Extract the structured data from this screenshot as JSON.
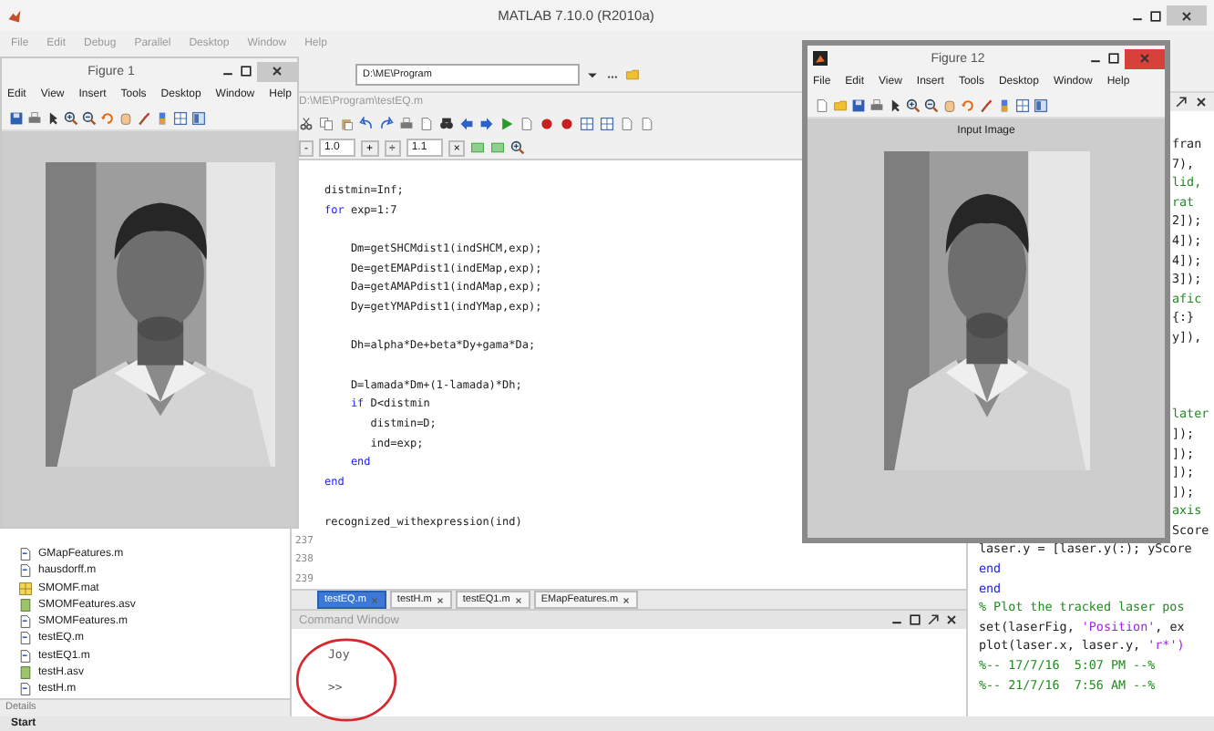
{
  "matlab_window": {
    "title": "MATLAB 7.10.0 (R2010a)",
    "menu": [
      "File",
      "Edit",
      "Debug",
      "Parallel",
      "Desktop",
      "Window",
      "Help"
    ],
    "current_folder": "D:\\ME\\Program"
  },
  "file_browser": {
    "files": [
      {
        "name": "GMapFeatures.m",
        "kind": "script"
      },
      {
        "name": "hausdorff.m",
        "kind": "script"
      },
      {
        "name": "SMOMF.mat",
        "kind": "matrix"
      },
      {
        "name": "SMOMFeatures.asv",
        "kind": "autosave"
      },
      {
        "name": "SMOMFeatures.m",
        "kind": "script"
      },
      {
        "name": "testEQ.m",
        "kind": "script"
      },
      {
        "name": "testEQ1.m",
        "kind": "script"
      },
      {
        "name": "testH.asv",
        "kind": "autosave"
      },
      {
        "name": "testH.m",
        "kind": "script"
      }
    ],
    "details_label": "Details"
  },
  "editor": {
    "title": "D:\\ME\\Program\\testEQ.m",
    "cell_toolbar": [
      {
        "text": "-",
        "kind": "button"
      },
      {
        "text": "1.0",
        "kind": "field"
      },
      {
        "text": "+",
        "kind": "button"
      },
      {
        "text": "÷",
        "kind": "button"
      },
      {
        "text": "1.1",
        "kind": "field"
      },
      {
        "text": "×",
        "kind": "button"
      }
    ],
    "lines": [
      {
        "kind": "code",
        "tokens": [
          {
            "text": "distmin=Inf;",
            "kind": "plain"
          }
        ]
      },
      {
        "kind": "code",
        "tokens": [
          {
            "text": "for",
            "kind": "keyword"
          },
          {
            "text": " exp=1:7",
            "kind": "plain"
          }
        ]
      },
      {
        "kind": "blank"
      },
      {
        "kind": "code",
        "tokens": [
          {
            "text": "    Dm=getSHCMdist1(indSHCM,exp);",
            "kind": "plain"
          }
        ]
      },
      {
        "kind": "code",
        "tokens": [
          {
            "text": "    De=getEMAPdist1(indEMap,exp);",
            "kind": "plain"
          }
        ]
      },
      {
        "kind": "code",
        "tokens": [
          {
            "text": "    Da=getAMAPdist1(indAMap,exp);",
            "kind": "plain"
          }
        ]
      },
      {
        "kind": "code",
        "tokens": [
          {
            "text": "    Dy=getYMAPdist1(indYMap,exp);",
            "kind": "plain"
          }
        ]
      },
      {
        "kind": "blank"
      },
      {
        "kind": "code",
        "tokens": [
          {
            "text": "    Dh=alpha*De+beta*Dy+gama*Da;",
            "kind": "plain"
          }
        ]
      },
      {
        "kind": "blank"
      },
      {
        "kind": "code",
        "tokens": [
          {
            "text": "    D=lamada*Dm+(1-lamada)*Dh;",
            "kind": "plain"
          }
        ]
      },
      {
        "kind": "code",
        "tokens": [
          {
            "text": "    if",
            "kind": "keyword"
          },
          {
            "text": " D<distmin",
            "kind": "plain"
          }
        ]
      },
      {
        "kind": "code",
        "tokens": [
          {
            "text": "       distmin=D;",
            "kind": "plain"
          }
        ]
      },
      {
        "kind": "code",
        "tokens": [
          {
            "text": "       ind=exp;",
            "kind": "plain"
          }
        ]
      },
      {
        "kind": "code",
        "tokens": [
          {
            "text": "    end",
            "kind": "keyword"
          }
        ]
      },
      {
        "kind": "code",
        "tokens": [
          {
            "text": "end",
            "kind": "keyword"
          }
        ]
      },
      {
        "kind": "blank"
      },
      {
        "kind": "code",
        "tokens": [
          {
            "text": "recognized_withexpression(ind)",
            "kind": "plain"
          }
        ]
      },
      {
        "kind": "blank",
        "number": "237"
      },
      {
        "kind": "blank",
        "number": "238"
      },
      {
        "kind": "blank",
        "number": "239"
      }
    ],
    "tabs": [
      {
        "label": "testEQ.m",
        "selected": true
      },
      {
        "label": "testH.m",
        "selected": false
      },
      {
        "label": "testEQ1.m",
        "selected": false
      },
      {
        "label": "EMapFeatures.m",
        "selected": false
      }
    ]
  },
  "command_window": {
    "title": "Command Window",
    "output": "Joy",
    "prompt": ">>",
    "annotation": {
      "kind": "circle"
    }
  },
  "side_code": {
    "lines": [
      {
        "kind": "fragment",
        "tokens": [
          {
            "text": "fran",
            "kind": "plain"
          }
        ]
      },
      {
        "kind": "fragment",
        "tokens": [
          {
            "text": "7),",
            "kind": "plain"
          }
        ]
      },
      {
        "kind": "fragment",
        "tokens": [
          {
            "text": "lid,",
            "kind": "comment"
          }
        ]
      },
      {
        "kind": "fragment",
        "tokens": [
          {
            "text": "rat",
            "kind": "comment"
          }
        ]
      },
      {
        "kind": "fragment",
        "tokens": [
          {
            "text": "2]);",
            "kind": "plain"
          }
        ]
      },
      {
        "kind": "fragment",
        "tokens": [
          {
            "text": "4]);",
            "kind": "plain"
          }
        ]
      },
      {
        "kind": "fragment",
        "tokens": [
          {
            "text": "4]);",
            "kind": "plain"
          }
        ]
      },
      {
        "kind": "fragment",
        "tokens": [
          {
            "text": "3]);",
            "kind": "plain"
          }
        ]
      },
      {
        "kind": "fragment",
        "tokens": [
          {
            "text": "afic",
            "kind": "comment"
          }
        ]
      },
      {
        "kind": "fragment",
        "tokens": [
          {
            "text": "{:}",
            "kind": "plain"
          }
        ]
      },
      {
        "kind": "fragment",
        "tokens": [
          {
            "text": "y]),",
            "kind": "plain"
          }
        ]
      },
      {
        "kind": "blank"
      },
      {
        "kind": "blank"
      },
      {
        "kind": "blank"
      },
      {
        "kind": "fragment",
        "tokens": [
          {
            "text": "later",
            "kind": "comment"
          }
        ]
      },
      {
        "kind": "fragment",
        "tokens": [
          {
            "text": "]);",
            "kind": "plain"
          }
        ]
      },
      {
        "kind": "fragment",
        "tokens": [
          {
            "text": "]);",
            "kind": "plain"
          }
        ]
      },
      {
        "kind": "fragment",
        "tokens": [
          {
            "text": "]);",
            "kind": "plain"
          }
        ]
      },
      {
        "kind": "fragment",
        "tokens": [
          {
            "text": "]);",
            "kind": "plain"
          }
        ]
      },
      {
        "kind": "fragment",
        "tokens": [
          {
            "text": "axis",
            "kind": "comment"
          }
        ]
      },
      {
        "kind": "fragment",
        "tokens": [
          {
            "text": "Score",
            "kind": "plain"
          }
        ]
      },
      {
        "kind": "full",
        "tokens": [
          {
            "text": "laser.y = [laser.y(:); yScore",
            "kind": "plain"
          }
        ]
      },
      {
        "kind": "full",
        "tokens": [
          {
            "text": "end",
            "kind": "keyword"
          }
        ]
      },
      {
        "kind": "full",
        "tokens": [
          {
            "text": "end",
            "kind": "keyword"
          }
        ]
      },
      {
        "kind": "full",
        "tokens": [
          {
            "text": "% Plot the tracked laser pos",
            "kind": "comment"
          }
        ]
      },
      {
        "kind": "full",
        "tokens": [
          {
            "text": "set(laserFig, ",
            "kind": "plain"
          },
          {
            "text": "'Position'",
            "kind": "string"
          },
          {
            "text": ", ex",
            "kind": "plain"
          }
        ]
      },
      {
        "kind": "full",
        "tokens": [
          {
            "text": "plot(laser.x, laser.y, ",
            "kind": "plain"
          },
          {
            "text": "'r*')",
            "kind": "string"
          }
        ]
      },
      {
        "kind": "full",
        "tokens": [
          {
            "text": "%-- 17/7/16  5:07 PM --%",
            "kind": "comment"
          }
        ]
      },
      {
        "kind": "full",
        "tokens": [
          {
            "text": "%-- 21/7/16  7:56 AM --%",
            "kind": "comment"
          }
        ]
      }
    ]
  },
  "figure_windows": [
    {
      "title": "Figure 1",
      "menu": [
        "Edit",
        "View",
        "Insert",
        "Tools",
        "Desktop",
        "Window",
        "Help"
      ],
      "image": {
        "kind": "picture"
      }
    },
    {
      "title": "Figure 12",
      "menu": [
        "File",
        "Edit",
        "View",
        "Insert",
        "Tools",
        "Desktop",
        "Window",
        "Help"
      ],
      "axes_title": "Input Image",
      "image": {
        "kind": "picture"
      }
    }
  ],
  "taskbar": {
    "start_label": "Start"
  }
}
